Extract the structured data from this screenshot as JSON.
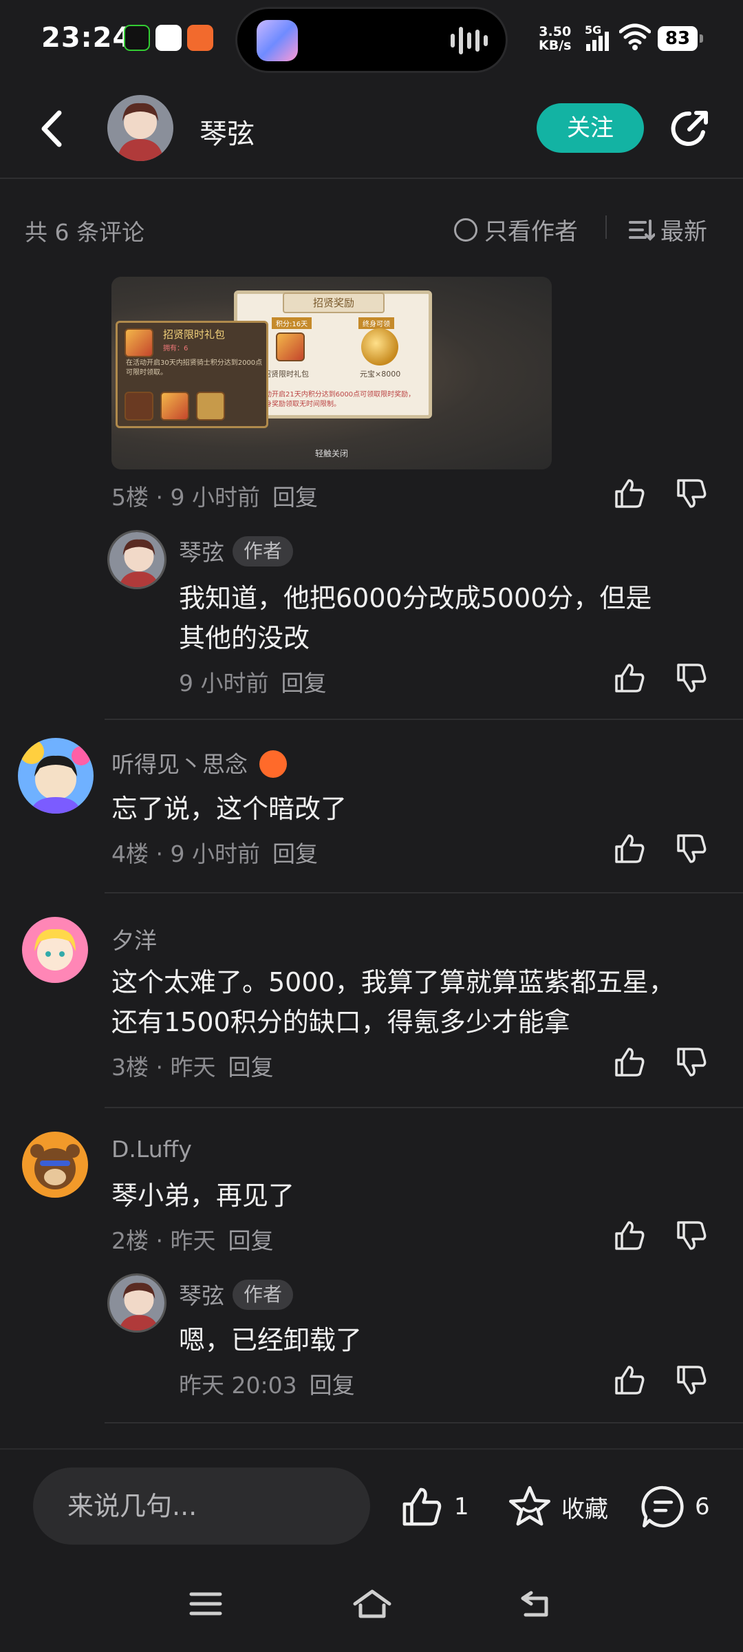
{
  "status_bar": {
    "time": "23:24",
    "net_speed_value": "3.50",
    "net_speed_unit": "KB/s",
    "network": "5G",
    "battery": "83"
  },
  "header": {
    "title": "琴弦",
    "follow_label": "关注"
  },
  "filter": {
    "count_label": "共 6 条评论",
    "author_only_label": "只看作者",
    "sort_label": "最新"
  },
  "screenshot": {
    "panel_title": "招贤奖励",
    "card_title": "招贤限时礼包",
    "card_owned": "拥有：6",
    "card_text": "在活动开启30天内招贤骑士积分达到2000点可限时领取。",
    "left_tag": "积分:16天",
    "right_tag": "终身可领",
    "gift_label": "招贤限时礼包",
    "coin_label": "元宝×8000",
    "panel_note": "活动开启21天内积分达到6000点可领取限时奖励，终身奖励领取无时间限制。",
    "footer": "轻触关闭"
  },
  "comments": [
    {
      "floor_meta": "5楼 · 9 小时前",
      "reply_label": "回复",
      "replies": [
        {
          "name": "琴弦",
          "badge": "作者",
          "text_line1": "我知道，他把6000分改成5000分，但是",
          "text_line2": "其他的没改",
          "time": "9 小时前",
          "reply_label": "回复"
        }
      ]
    },
    {
      "name": "听得见丶思念",
      "text": "忘了说，这个暗改了",
      "floor_meta": "4楼 · 9 小时前",
      "reply_label": "回复"
    },
    {
      "name": "夕洋",
      "text_line1": "这个太难了。5000，我算了算就算蓝紫都五星，",
      "text_line2": "还有1500积分的缺口，得氪多少才能拿",
      "floor_meta": "3楼 · 昨天",
      "reply_label": "回复"
    },
    {
      "name": "D.Luffy",
      "text": "琴小弟，再见了",
      "floor_meta": "2楼 · 昨天",
      "reply_label": "回复",
      "replies": [
        {
          "name": "琴弦",
          "badge": "作者",
          "text": "嗯，已经卸载了",
          "time": "昨天 20:03",
          "reply_label": "回复"
        }
      ]
    }
  ],
  "bottom_bar": {
    "input_placeholder": "来说几句...",
    "like_count": "1",
    "favorite_label": "收藏",
    "comment_count": "6"
  },
  "colors": {
    "background": "#1c1c1e",
    "accent": "#13b3a3",
    "text_primary": "#f0f0f0",
    "text_secondary": "#8c8c90"
  }
}
